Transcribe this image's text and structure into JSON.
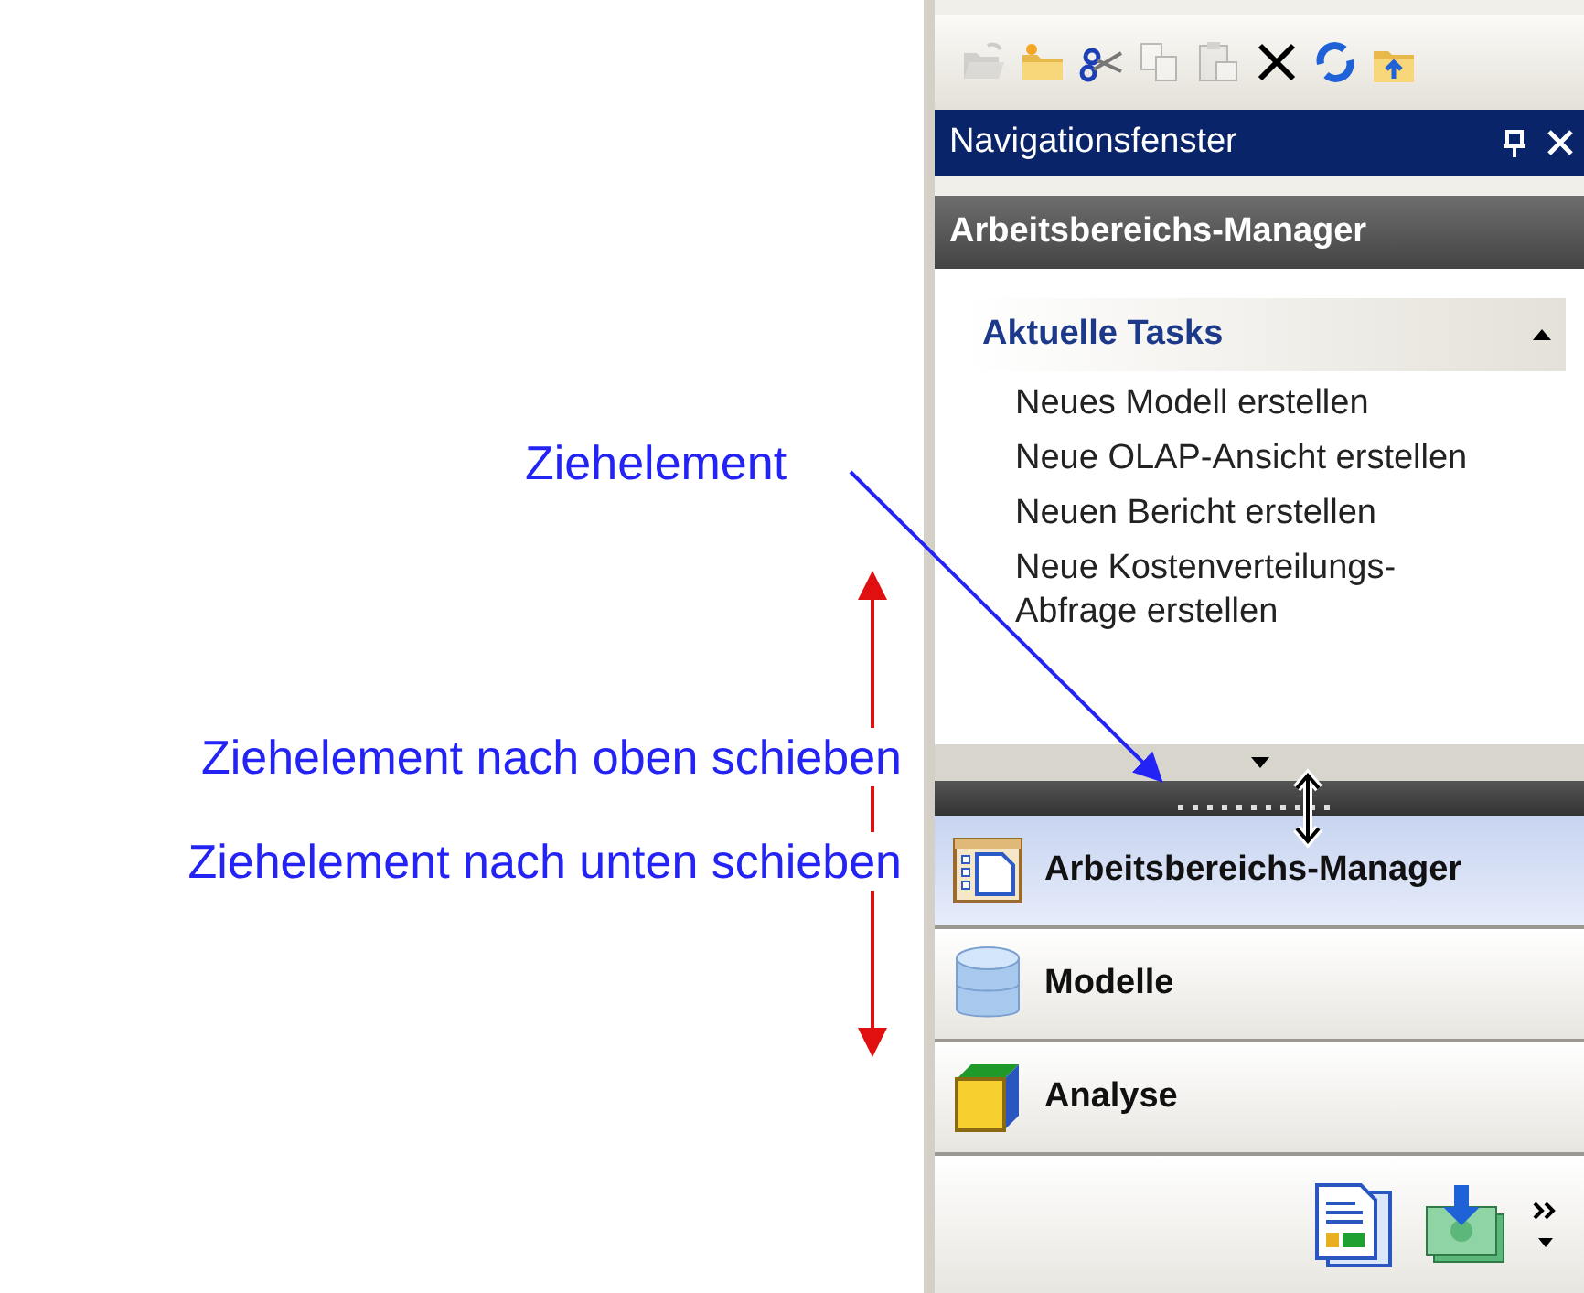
{
  "annotations": [
    {
      "kind": "pointer",
      "text": "Ziehelement"
    },
    {
      "kind": "up",
      "text": "Ziehelement nach oben schieben"
    },
    {
      "kind": "down",
      "text": "Ziehelement nach unten schieben"
    }
  ],
  "toolbar": [
    {
      "kind": "open",
      "disabled": true
    },
    {
      "kind": "new-folder",
      "disabled": false
    },
    {
      "kind": "cut",
      "disabled": false
    },
    {
      "kind": "copy",
      "disabled": true
    },
    {
      "kind": "paste",
      "disabled": true
    },
    {
      "kind": "delete",
      "disabled": false
    },
    {
      "kind": "refresh",
      "disabled": false
    },
    {
      "kind": "up-folder",
      "disabled": false
    }
  ],
  "window": {
    "title": "Navigationsfenster"
  },
  "section": {
    "title": "Arbeitsbereichs-Manager"
  },
  "tasks": {
    "title": "Aktuelle Tasks",
    "expanded": true,
    "items": [
      "Neues Modell erstellen",
      "Neue OLAP-Ansicht erstellen",
      "Neuen Bericht erstellen",
      "Neue Kostenverteilungs-Abfrage erstellen"
    ]
  },
  "nav_buttons": [
    {
      "kind": "manager",
      "label": "Arbeitsbereichs-Manager",
      "selected": true
    },
    {
      "kind": "models",
      "label": "Modelle",
      "selected": false
    },
    {
      "kind": "analysis",
      "label": "Analyse",
      "selected": false
    }
  ],
  "bottom_icons": [
    {
      "kind": "report"
    },
    {
      "kind": "import"
    }
  ]
}
